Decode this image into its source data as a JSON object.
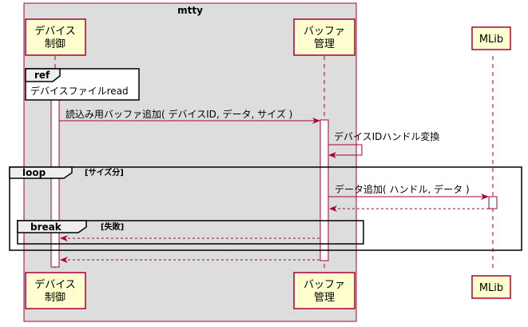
{
  "group": {
    "title": "mtty"
  },
  "participants": {
    "device": {
      "line1": "デバイス",
      "line2": "制御"
    },
    "buffer": {
      "line1": "バッファ",
      "line2": "管理"
    },
    "mlib": {
      "name": "MLib"
    }
  },
  "ref": {
    "tag": "ref",
    "text": "デバイスファイルread"
  },
  "messages": {
    "m1": "読込み用バッファ追加( デバイスID, データ, サイズ )",
    "m2": "デバイスIDハンドル変換",
    "m3": "データ追加( ハンドル, データ )"
  },
  "loop": {
    "tag": "loop",
    "guard": "[サイズ分]"
  },
  "break": {
    "tag": "break",
    "guard": "[失敗]"
  },
  "colors": {
    "participant_fill": "#FEFECE",
    "participant_border": "#A80036",
    "group_fill": "#DDDDDD",
    "arrow": "#A80036"
  }
}
